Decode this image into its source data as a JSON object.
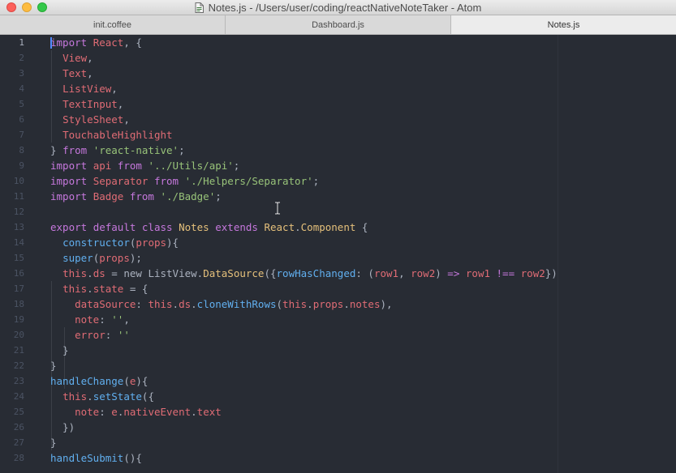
{
  "window": {
    "title": "Notes.js - /Users/user/coding/reactNativeNoteTaker - Atom"
  },
  "tabs": [
    {
      "label": "init.coffee",
      "active": false
    },
    {
      "label": "Dashboard.js",
      "active": false
    },
    {
      "label": "Notes.js",
      "active": true
    }
  ],
  "editor": {
    "current_line": 1,
    "line_numbers": [
      "1",
      "2",
      "3",
      "4",
      "5",
      "6",
      "7",
      "8",
      "9",
      "10",
      "11",
      "12",
      "13",
      "14",
      "15",
      "16",
      "17",
      "18",
      "19",
      "20",
      "21",
      "22",
      "23",
      "24",
      "25",
      "26",
      "27",
      "28"
    ],
    "lines": [
      [
        [
          "kw",
          "import"
        ],
        [
          "pl",
          " "
        ],
        [
          "var",
          "React"
        ],
        [
          "pl",
          ", {"
        ]
      ],
      [
        [
          "pl",
          "  "
        ],
        [
          "var",
          "View"
        ],
        [
          "pl",
          ","
        ]
      ],
      [
        [
          "pl",
          "  "
        ],
        [
          "var",
          "Text"
        ],
        [
          "pl",
          ","
        ]
      ],
      [
        [
          "pl",
          "  "
        ],
        [
          "var",
          "ListView"
        ],
        [
          "pl",
          ","
        ]
      ],
      [
        [
          "pl",
          "  "
        ],
        [
          "var",
          "TextInput"
        ],
        [
          "pl",
          ","
        ]
      ],
      [
        [
          "pl",
          "  "
        ],
        [
          "var",
          "StyleSheet"
        ],
        [
          "pl",
          ","
        ]
      ],
      [
        [
          "pl",
          "  "
        ],
        [
          "var",
          "TouchableHighlight"
        ]
      ],
      [
        [
          "pl",
          "} "
        ],
        [
          "kw",
          "from"
        ],
        [
          "pl",
          " "
        ],
        [
          "str",
          "'react-native'"
        ],
        [
          "pl",
          ";"
        ]
      ],
      [
        [
          "kw",
          "import"
        ],
        [
          "pl",
          " "
        ],
        [
          "var",
          "api"
        ],
        [
          "pl",
          " "
        ],
        [
          "kw",
          "from"
        ],
        [
          "pl",
          " "
        ],
        [
          "str",
          "'../Utils/api'"
        ],
        [
          "pl",
          ";"
        ]
      ],
      [
        [
          "kw",
          "import"
        ],
        [
          "pl",
          " "
        ],
        [
          "var",
          "Separator"
        ],
        [
          "pl",
          " "
        ],
        [
          "kw",
          "from"
        ],
        [
          "pl",
          " "
        ],
        [
          "str",
          "'./Helpers/Separator'"
        ],
        [
          "pl",
          ";"
        ]
      ],
      [
        [
          "kw",
          "import"
        ],
        [
          "pl",
          " "
        ],
        [
          "var",
          "Badge"
        ],
        [
          "pl",
          " "
        ],
        [
          "kw",
          "from"
        ],
        [
          "pl",
          " "
        ],
        [
          "str",
          "'./Badge'"
        ],
        [
          "pl",
          ";"
        ]
      ],
      [],
      [
        [
          "kw",
          "export"
        ],
        [
          "pl",
          " "
        ],
        [
          "kw",
          "default"
        ],
        [
          "pl",
          " "
        ],
        [
          "kw",
          "class"
        ],
        [
          "pl",
          " "
        ],
        [
          "cls",
          "Notes"
        ],
        [
          "pl",
          " "
        ],
        [
          "kw",
          "extends"
        ],
        [
          "pl",
          " "
        ],
        [
          "cls",
          "React"
        ],
        [
          "pl",
          "."
        ],
        [
          "cls",
          "Component"
        ],
        [
          "pl",
          " {"
        ]
      ],
      [
        [
          "pl",
          "  "
        ],
        [
          "fn",
          "constructor"
        ],
        [
          "pl",
          "("
        ],
        [
          "var",
          "props"
        ],
        [
          "pl",
          "){"
        ]
      ],
      [
        [
          "pl",
          "  "
        ],
        [
          "fn",
          "super"
        ],
        [
          "pl",
          "("
        ],
        [
          "var",
          "props"
        ],
        [
          "pl",
          ");"
        ]
      ],
      [
        [
          "pl",
          "  "
        ],
        [
          "var",
          "this"
        ],
        [
          "pl",
          "."
        ],
        [
          "prop",
          "ds"
        ],
        [
          "pl",
          " = new "
        ],
        [
          "pl",
          "ListView"
        ],
        [
          "pl",
          "."
        ],
        [
          "cls",
          "DataSource"
        ],
        [
          "pl",
          "({"
        ],
        [
          "fn",
          "rowHasChanged"
        ],
        [
          "pl",
          ": ("
        ],
        [
          "var",
          "row1"
        ],
        [
          "pl",
          ", "
        ],
        [
          "var",
          "row2"
        ],
        [
          "pl",
          ") "
        ],
        [
          "op",
          "=>"
        ],
        [
          "pl",
          " "
        ],
        [
          "var",
          "row1"
        ],
        [
          "pl",
          " "
        ],
        [
          "op",
          "!=="
        ],
        [
          "pl",
          " "
        ],
        [
          "var",
          "row2"
        ],
        [
          "pl",
          "})"
        ]
      ],
      [
        [
          "pl",
          "  "
        ],
        [
          "var",
          "this"
        ],
        [
          "pl",
          "."
        ],
        [
          "prop",
          "state"
        ],
        [
          "pl",
          " = {"
        ]
      ],
      [
        [
          "pl",
          "    "
        ],
        [
          "prop",
          "dataSource"
        ],
        [
          "pl",
          ": "
        ],
        [
          "var",
          "this"
        ],
        [
          "pl",
          "."
        ],
        [
          "prop",
          "ds"
        ],
        [
          "pl",
          "."
        ],
        [
          "fn",
          "cloneWithRows"
        ],
        [
          "pl",
          "("
        ],
        [
          "var",
          "this"
        ],
        [
          "pl",
          "."
        ],
        [
          "prop",
          "props"
        ],
        [
          "pl",
          "."
        ],
        [
          "prop",
          "notes"
        ],
        [
          "pl",
          "),"
        ]
      ],
      [
        [
          "pl",
          "    "
        ],
        [
          "prop",
          "note"
        ],
        [
          "pl",
          ": "
        ],
        [
          "str",
          "''"
        ],
        [
          "pl",
          ","
        ]
      ],
      [
        [
          "pl",
          "    "
        ],
        [
          "prop",
          "error"
        ],
        [
          "pl",
          ": "
        ],
        [
          "str",
          "''"
        ]
      ],
      [
        [
          "pl",
          "  }"
        ]
      ],
      [
        [
          "pl",
          "}"
        ]
      ],
      [
        [
          "fn",
          "handleChange"
        ],
        [
          "pl",
          "("
        ],
        [
          "var",
          "e"
        ],
        [
          "pl",
          "){"
        ]
      ],
      [
        [
          "pl",
          "  "
        ],
        [
          "var",
          "this"
        ],
        [
          "pl",
          "."
        ],
        [
          "fn",
          "setState"
        ],
        [
          "pl",
          "({"
        ]
      ],
      [
        [
          "pl",
          "    "
        ],
        [
          "prop",
          "note"
        ],
        [
          "pl",
          ": "
        ],
        [
          "var",
          "e"
        ],
        [
          "pl",
          "."
        ],
        [
          "prop",
          "nativeEvent"
        ],
        [
          "pl",
          "."
        ],
        [
          "prop",
          "text"
        ]
      ],
      [
        [
          "pl",
          "  })"
        ]
      ],
      [
        [
          "pl",
          "}"
        ]
      ],
      [
        [
          "fn",
          "handleSubmit"
        ],
        [
          "pl",
          "(){"
        ]
      ]
    ]
  },
  "colors": {
    "background": "#282c34",
    "keyword": "#c678dd",
    "variable": "#e06c75",
    "string": "#98c379",
    "class": "#e5c07b",
    "function": "#61afef",
    "plain": "#abb2bf",
    "line_number": "#4b5363"
  },
  "icons": {
    "title_file": "document-icon",
    "mouse_cursor": "text-ibeam-icon"
  }
}
